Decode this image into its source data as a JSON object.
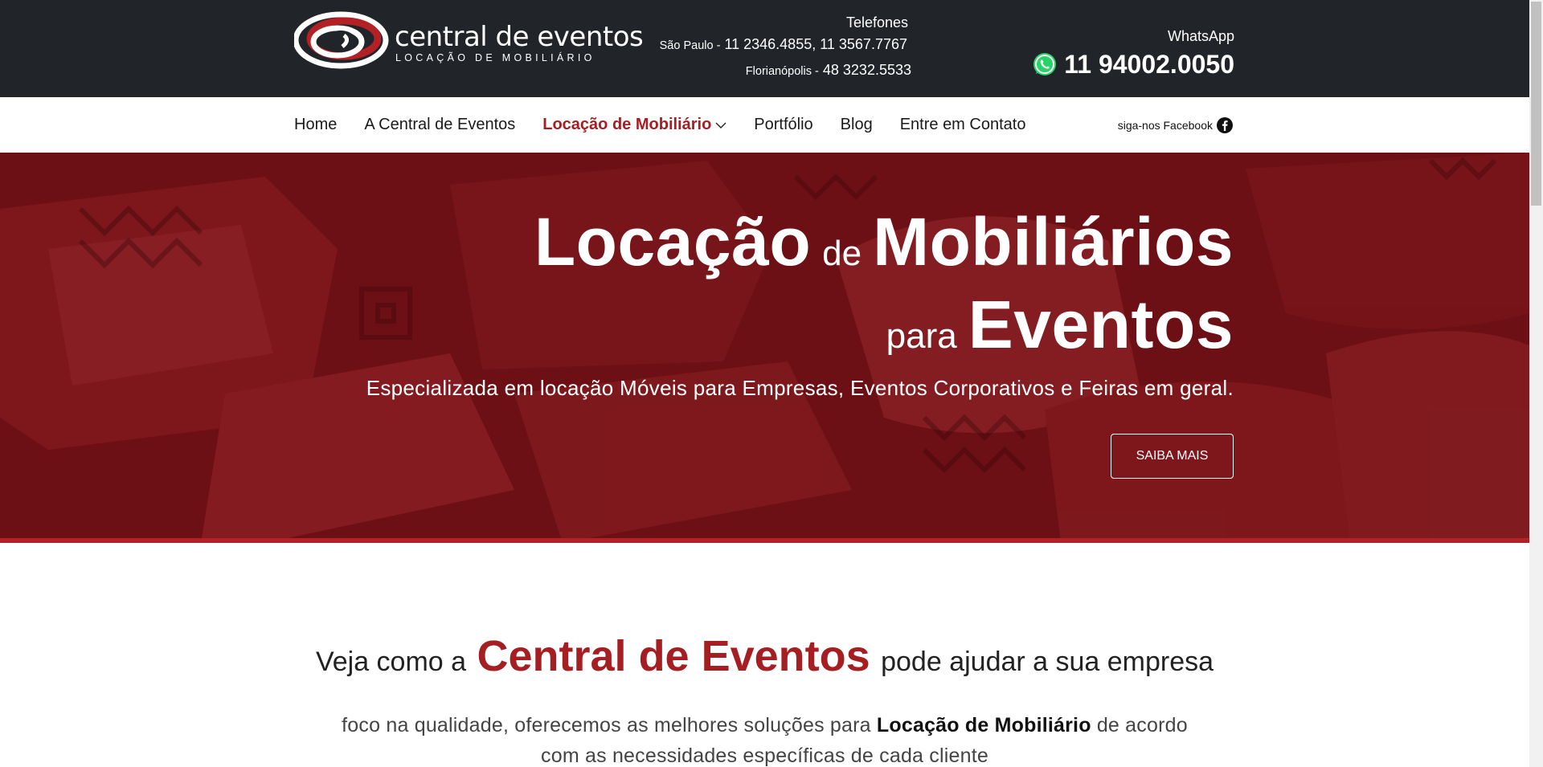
{
  "brand": {
    "name": "central de eventos",
    "tagline": "LOCAÇÃO DE MOBILIÁRIO",
    "logo_colors": {
      "swirl": "#ffffff",
      "accent": "#b32026"
    }
  },
  "contact": {
    "phones_title": "Telefones",
    "sp_city": "São Paulo -",
    "sp_numbers": "11 2346.4855, 11 3567.7767",
    "floripa_city": "Florianópolis -",
    "floripa_number": "48 3232.5533",
    "whatsapp_label": "WhatsApp",
    "whatsapp_number": "11 94002.0050",
    "whatsapp_icon": "whatsapp-icon"
  },
  "nav": {
    "items": [
      {
        "label": "Home"
      },
      {
        "label": "A Central de Eventos"
      },
      {
        "label": "Locação de Mobiliário",
        "active": true
      },
      {
        "label": "Portfólio"
      },
      {
        "label": "Blog"
      },
      {
        "label": "Entre em Contato"
      }
    ],
    "facebook_label": "siga-nos Facebook",
    "facebook_icon": "facebook-icon"
  },
  "hero": {
    "word1": "Locação",
    "word2": "de",
    "word3": "Mobiliários",
    "word4": "para",
    "word5": "Eventos",
    "subtitle": "Especializada em locação Móveis para Empresas, Eventos Corporativos e Feiras em geral.",
    "cta": "SAIBA MAIS"
  },
  "intro": {
    "pre": "Veja como a",
    "highlight": "Central de Eventos",
    "post": "pode ajudar a sua empresa",
    "text_pre": "foco na qualidade, oferecemos as melhores soluções para",
    "text_bold": "Locação de Mobiliário",
    "text_post": "de acordo com as necessidades específicas de cada cliente"
  },
  "colors": {
    "topbar": "#212429",
    "accent": "#a51e22",
    "hero_red": "#7a1318"
  }
}
